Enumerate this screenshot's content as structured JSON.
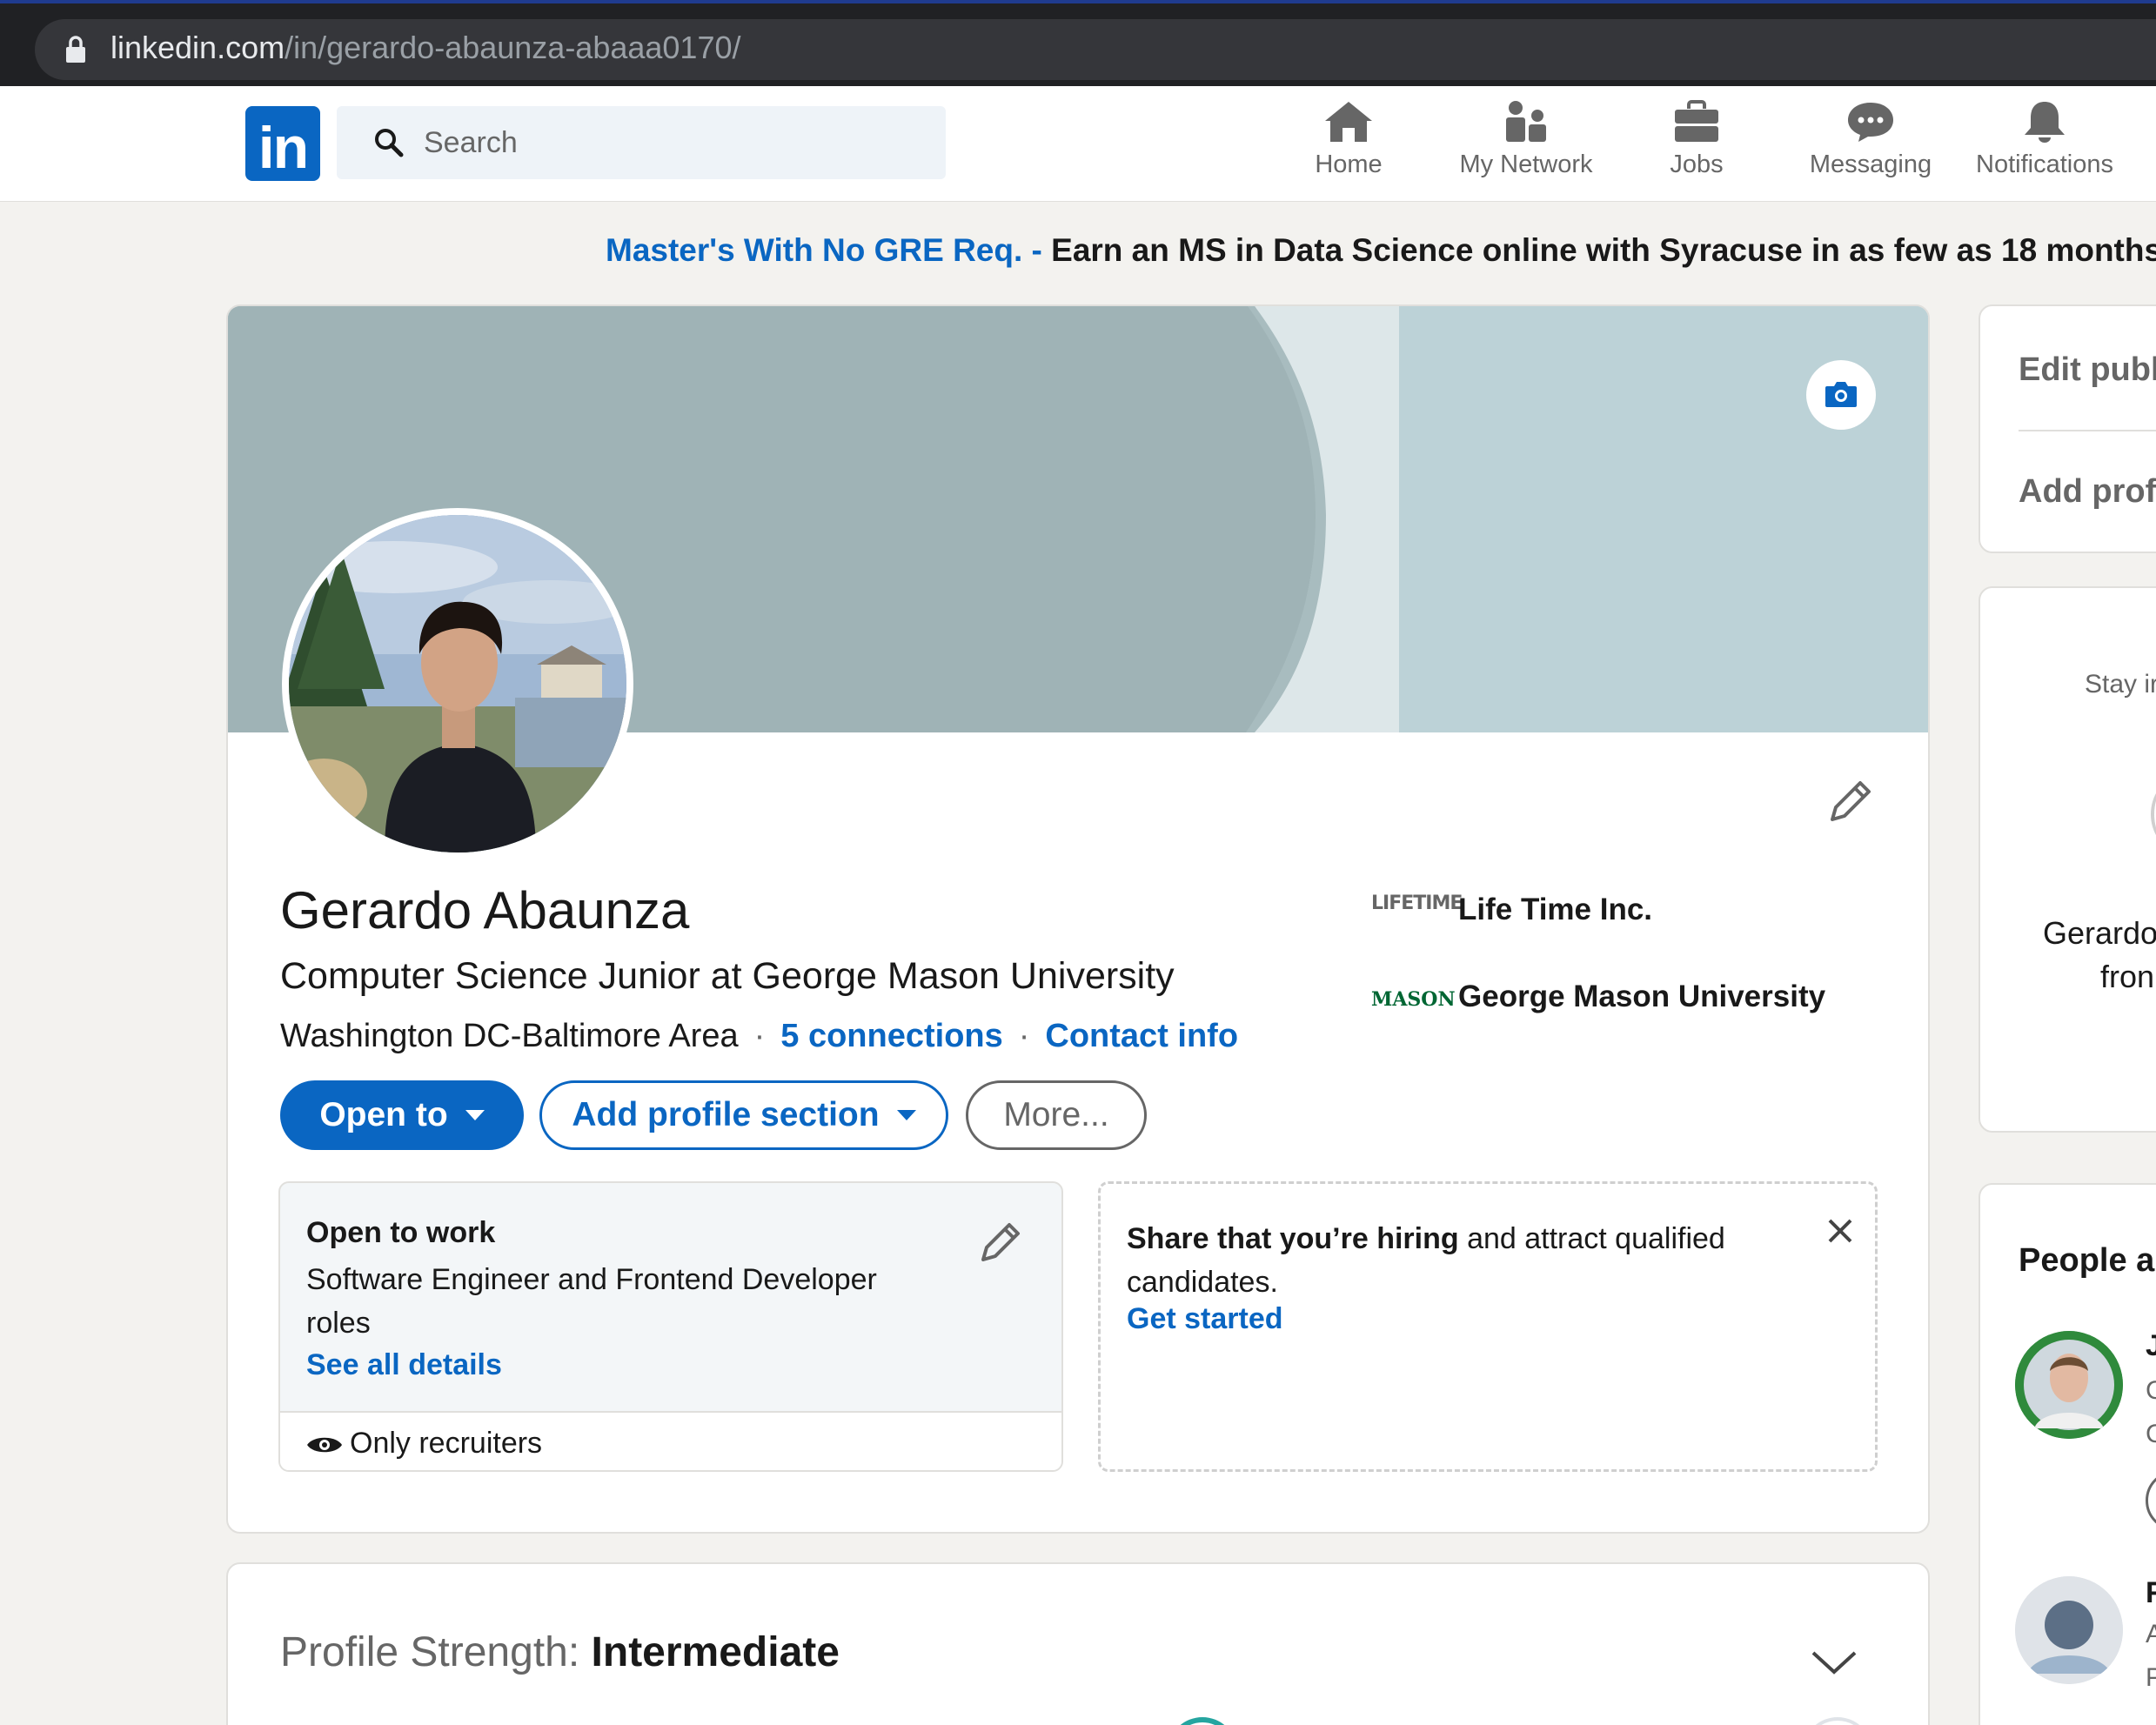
{
  "browser": {
    "url_domain": "linkedin.com",
    "url_path": "/in/gerardo-abaunza-abaaa0170/"
  },
  "nav": {
    "logo": "in",
    "search_placeholder": "Search",
    "items": [
      {
        "label": "Home",
        "icon": "home-icon"
      },
      {
        "label": "My Network",
        "icon": "my-network-icon"
      },
      {
        "label": "Jobs",
        "icon": "jobs-icon"
      },
      {
        "label": "Messaging",
        "icon": "messaging-icon"
      },
      {
        "label": "Notifications",
        "icon": "notifications-icon"
      }
    ]
  },
  "ad": {
    "link": "Master's With No GRE Req. -",
    "text": "Earn an MS in Data Science online with Syracuse in as few as 18 months"
  },
  "profile": {
    "name": "Gerardo Abaunza",
    "headline": "Computer Science Junior at George Mason University",
    "location": "Washington DC-Baltimore Area",
    "connections": "5 connections",
    "contact": "Contact info",
    "companies": [
      {
        "name": "Life Time Inc.",
        "logo_text": "LIFETIME"
      },
      {
        "name": "George Mason University",
        "logo_text": "MASON"
      }
    ],
    "buttons": {
      "open_to": "Open to",
      "add_section": "Add profile section",
      "more": "More..."
    },
    "open_to_work": {
      "title": "Open to work",
      "roles": "Software Engineer and Frontend Developer roles",
      "link": "See all details",
      "visibility": "Only recruiters"
    },
    "hiring": {
      "bold": "Share that you’re hiring",
      "rest": "and attract qualified candidates.",
      "link": "Get started"
    }
  },
  "strength": {
    "label": "Profile Strength:",
    "level": "Intermediate"
  },
  "sidebar": {
    "edit_public": "Edit publ",
    "add_profile": "Add prof",
    "stay": "Stay ir",
    "name_line1": "Gerardo",
    "name_line2": "fron",
    "people_title": "People al",
    "person1_letter": "J",
    "person1_sub1": "C",
    "person1_sub2": "C",
    "person2_letter": "F",
    "person2_sub1": "A",
    "person2_sub2": "P"
  },
  "colors": {
    "brand": "#0a66c2",
    "cover_dark": "#9fb3b6",
    "cover_light": "#bcd2d7",
    "page_bg": "#f3f2ef"
  }
}
